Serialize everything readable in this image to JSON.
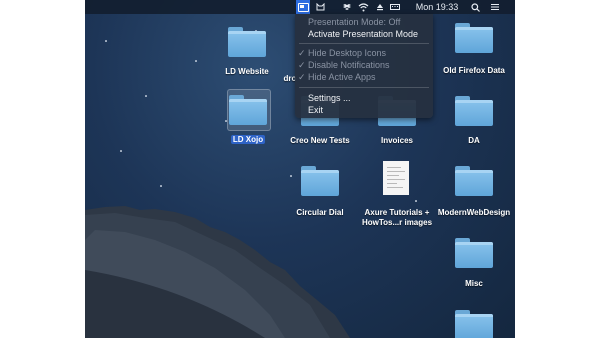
{
  "menubar": {
    "clock": "Mon 19:33",
    "icons": [
      "presentation-mode-icon",
      "cat-icon",
      "dropbox-icon",
      "wifi-icon",
      "eject-icon",
      "keyboard-icon",
      "search-icon",
      "control-center-icon"
    ]
  },
  "menu": {
    "status": "Presentation Mode: Off",
    "activate": "Activate Presentation Mode",
    "options": [
      {
        "label": "Hide Desktop Icons",
        "checked": true
      },
      {
        "label": "Disable Notifications",
        "checked": true
      },
      {
        "label": "Hide Active Apps",
        "checked": true
      }
    ],
    "settings": "Settings ...",
    "exit": "Exit",
    "check_glyph": "✓"
  },
  "desktop": {
    "items": [
      {
        "label": "LD Website"
      },
      {
        "label": "dro"
      },
      {
        "label": "Old Firefox Data"
      },
      {
        "label": "LD Xojo"
      },
      {
        "label": "Creo New Tests"
      },
      {
        "label": "Invoices"
      },
      {
        "label": "DA"
      },
      {
        "label": "Circular Dial"
      },
      {
        "label": "Axure Tutorials +"
      },
      {
        "label": "HowTos...r images"
      },
      {
        "label": "ModernWebDesign"
      },
      {
        "label": "Misc"
      }
    ]
  },
  "colors": {
    "accent": "#2e63c7",
    "folder": "#6fb1e3"
  }
}
